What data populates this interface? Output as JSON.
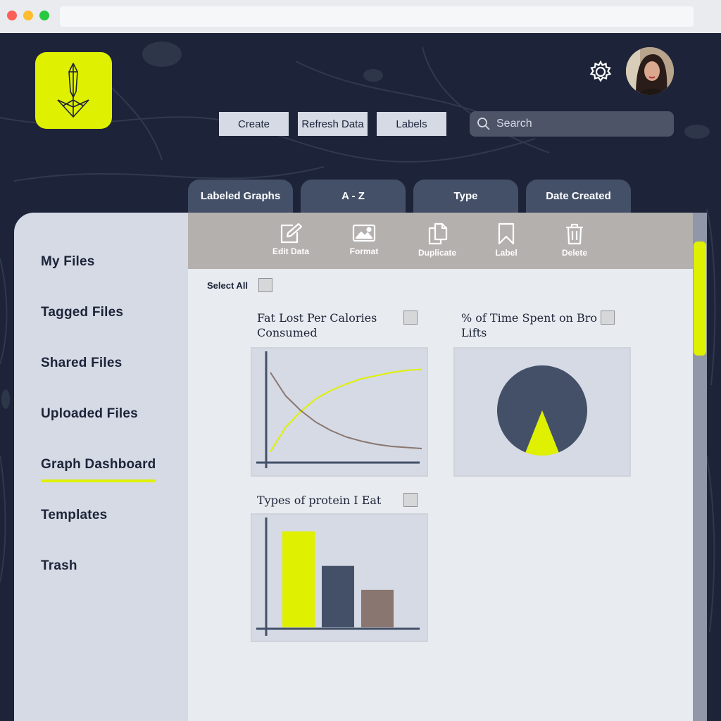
{
  "colors": {
    "accent": "#dff000",
    "navy": "#1d2439",
    "slate": "#435068",
    "brown": "#8a7670",
    "panel": "#d5dae4"
  },
  "header": {
    "create_label": "Create",
    "refresh_label": "Refresh Data",
    "labels_label": "Labels",
    "search_placeholder": "Search"
  },
  "tabs": [
    {
      "label": "Labeled Graphs"
    },
    {
      "label": "A - Z"
    },
    {
      "label": "Type"
    },
    {
      "label": "Date Created"
    }
  ],
  "sidebar": {
    "items": [
      {
        "label": "My Files"
      },
      {
        "label": "Tagged Files"
      },
      {
        "label": "Shared Files"
      },
      {
        "label": "Uploaded Files"
      },
      {
        "label": "Graph Dashboard",
        "active": true
      },
      {
        "label": "Templates"
      },
      {
        "label": "Trash"
      }
    ]
  },
  "toolbar": {
    "edit": "Edit Data",
    "format": "Format",
    "duplicate": "Duplicate",
    "label": "Label",
    "delete": "Delete"
  },
  "main": {
    "select_all": "Select All",
    "cards": [
      {
        "title_line1": "Fat Lost Per Calories",
        "title_line2": "Consumed",
        "type": "line"
      },
      {
        "title_line1": "% of Time Spent on Bro",
        "title_line2": "Lifts",
        "type": "pie"
      },
      {
        "title_line1": "Types of protein I Eat",
        "title_line2": "",
        "type": "bar"
      }
    ]
  },
  "chart_data": [
    {
      "type": "line",
      "title": "Fat Lost Per Calories Consumed",
      "series": [
        {
          "color": "#dff000",
          "values": [
            0.05,
            0.28,
            0.43,
            0.55,
            0.63,
            0.69,
            0.74,
            0.77,
            0.8,
            0.82,
            0.83
          ]
        },
        {
          "color": "#8a7670",
          "values": [
            0.8,
            0.58,
            0.44,
            0.33,
            0.25,
            0.19,
            0.15,
            0.12,
            0.1,
            0.09,
            0.08
          ]
        }
      ],
      "x": [
        0,
        1,
        2,
        3,
        4,
        5,
        6,
        7,
        8,
        9,
        10
      ],
      "ylim": [
        0,
        1
      ]
    },
    {
      "type": "pie",
      "title": "% of Time Spent on Bro Lifts",
      "slices": [
        {
          "color": "#435068",
          "value": 88
        },
        {
          "color": "#dff000",
          "value": 12
        }
      ]
    },
    {
      "type": "bar",
      "title": "Types of protein I Eat",
      "values": [
        100,
        64,
        39
      ],
      "colors": [
        "#dff000",
        "#435068",
        "#8a7670"
      ],
      "ylim": [
        0,
        110
      ]
    }
  ]
}
